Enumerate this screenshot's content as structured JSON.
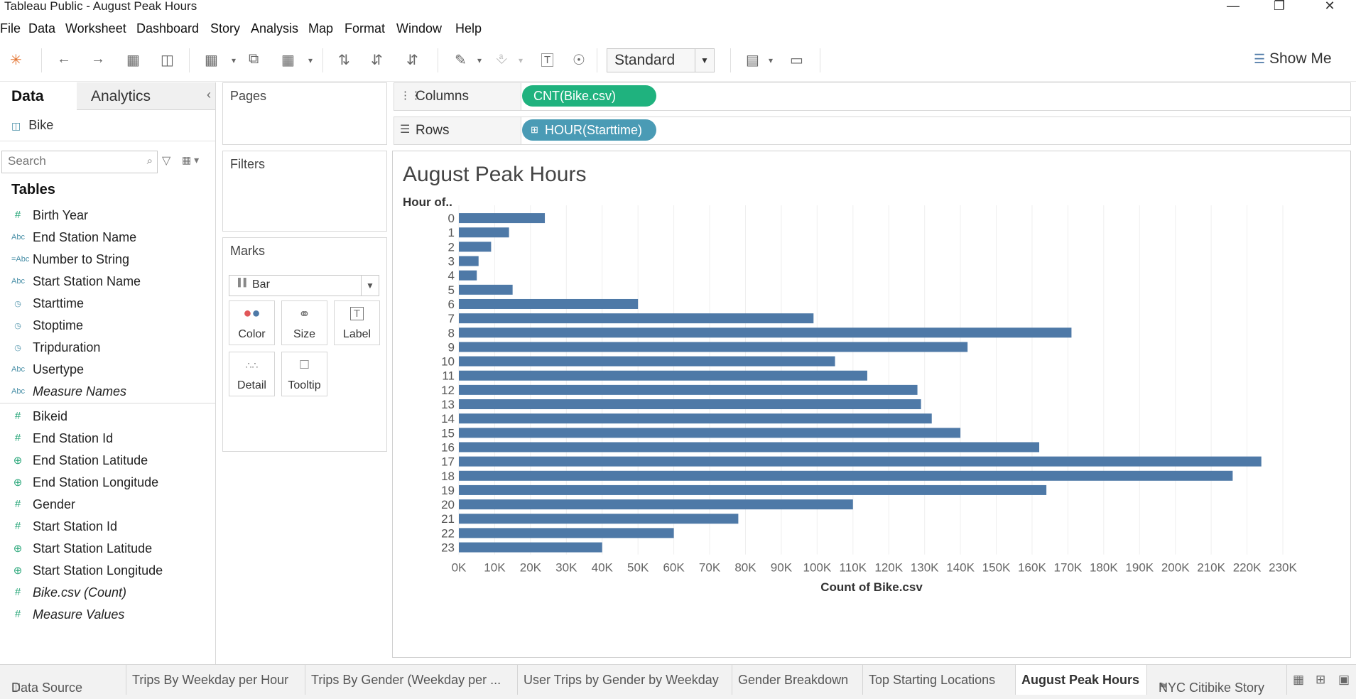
{
  "window": {
    "title": "Tableau Public - August Peak Hours"
  },
  "menu": [
    "File",
    "Data",
    "Worksheet",
    "Dashboard",
    "Story",
    "Analysis",
    "Map",
    "Format",
    "Window",
    "Help"
  ],
  "toolbar": {
    "fit_mode": "Standard",
    "show_me": "Show Me"
  },
  "left_pane": {
    "tab_data": "Data",
    "tab_analytics": "Analytics",
    "datasource": "Bike",
    "search_placeholder": "Search",
    "tables_heading": "Tables",
    "dimensions": [
      {
        "name": "Birth Year",
        "icon": "#",
        "italic": false
      },
      {
        "name": "End Station Name",
        "icon": "Abc",
        "italic": false
      },
      {
        "name": "Number to String",
        "icon": "=Abc",
        "italic": false
      },
      {
        "name": "Start Station Name",
        "icon": "Abc",
        "italic": false
      },
      {
        "name": "Starttime",
        "icon": "date",
        "italic": false
      },
      {
        "name": "Stoptime",
        "icon": "date",
        "italic": false
      },
      {
        "name": "Tripduration",
        "icon": "date",
        "italic": false
      },
      {
        "name": "Usertype",
        "icon": "Abc",
        "italic": false
      },
      {
        "name": "Measure Names",
        "icon": "Abc",
        "italic": true
      }
    ],
    "measures": [
      {
        "name": "Bikeid",
        "icon": "#",
        "italic": false
      },
      {
        "name": "End Station Id",
        "icon": "#",
        "italic": false
      },
      {
        "name": "End Station Latitude",
        "icon": "geo",
        "italic": false
      },
      {
        "name": "End Station Longitude",
        "icon": "geo",
        "italic": false
      },
      {
        "name": "Gender",
        "icon": "#",
        "italic": false
      },
      {
        "name": "Start Station Id",
        "icon": "#",
        "italic": false
      },
      {
        "name": "Start Station Latitude",
        "icon": "geo",
        "italic": false
      },
      {
        "name": "Start Station Longitude",
        "icon": "geo",
        "italic": false
      },
      {
        "name": "Bike.csv (Count)",
        "icon": "#",
        "italic": true
      },
      {
        "name": "Measure Values",
        "icon": "#",
        "italic": true
      }
    ]
  },
  "cards": {
    "pages": "Pages",
    "filters": "Filters",
    "marks": "Marks",
    "mark_type": "Bar",
    "mark_buttons": {
      "color": "Color",
      "size": "Size",
      "label": "Label",
      "detail": "Detail",
      "tooltip": "Tooltip"
    }
  },
  "shelves": {
    "columns_label": "Columns",
    "columns_pill": "CNT(Bike.csv)",
    "rows_label": "Rows",
    "rows_pill": "HOUR(Starttime)",
    "columns_color": "#1fb27e",
    "rows_color": "#4a9bb5"
  },
  "sheet_tabs": [
    {
      "label": "Data Source",
      "active": false
    },
    {
      "label": "Trips By Weekday per Hour",
      "active": false
    },
    {
      "label": "Trips By Gender (Weekday per ...",
      "active": false
    },
    {
      "label": "User Trips by Gender by Weekday",
      "active": false
    },
    {
      "label": "Gender Breakdown",
      "active": false
    },
    {
      "label": "Top Starting Locations",
      "active": false
    },
    {
      "label": "August Peak Hours",
      "active": true
    },
    {
      "label": "NYC Citibike Story",
      "active": false
    }
  ],
  "chart_data": {
    "type": "bar",
    "orientation": "horizontal",
    "title": "August Peak Hours",
    "ylabel": "Hour of..",
    "xlabel": "Count of Bike.csv",
    "categories": [
      "0",
      "1",
      "2",
      "3",
      "4",
      "5",
      "6",
      "7",
      "8",
      "9",
      "10",
      "11",
      "12",
      "13",
      "14",
      "15",
      "16",
      "17",
      "18",
      "19",
      "20",
      "21",
      "22",
      "23"
    ],
    "values": [
      24000,
      14000,
      9000,
      5500,
      5000,
      15000,
      50000,
      99000,
      171000,
      142000,
      105000,
      114000,
      128000,
      129000,
      132000,
      140000,
      162000,
      224000,
      216000,
      164000,
      110000,
      78000,
      60000,
      40000
    ],
    "xlim": [
      0,
      230000
    ],
    "xticks": [
      "0K",
      "10K",
      "20K",
      "30K",
      "40K",
      "50K",
      "60K",
      "70K",
      "80K",
      "90K",
      "100K",
      "110K",
      "120K",
      "130K",
      "140K",
      "150K",
      "160K",
      "170K",
      "180K",
      "190K",
      "200K",
      "210K",
      "220K",
      "230K"
    ],
    "grid": true,
    "bar_color": "#4e79a7"
  }
}
